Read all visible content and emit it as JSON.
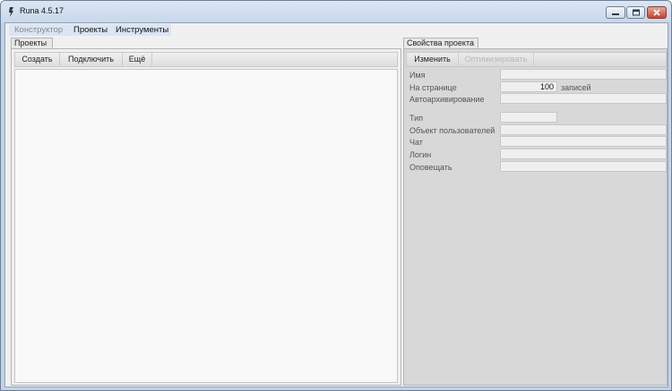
{
  "window": {
    "title": "Runa 4.5.17",
    "controls": [
      "minimize-icon",
      "maximize-icon",
      "close-icon"
    ]
  },
  "menu": {
    "items": [
      {
        "label": "Конструктор",
        "state": "disabled"
      },
      {
        "label": "Проекты",
        "state": "enabled"
      },
      {
        "label": "Инструменты",
        "state": "enabled"
      }
    ]
  },
  "projects_panel": {
    "tab_label": "Проекты",
    "toolbar": [
      {
        "label": "Создать",
        "state": "enabled"
      },
      {
        "label": "Подключить",
        "state": "enabled"
      },
      {
        "label": "Ещё",
        "state": "enabled"
      }
    ]
  },
  "properties_panel": {
    "tab_label": "Свойства проекта",
    "toolbar": [
      {
        "label": "Изменить",
        "state": "enabled"
      },
      {
        "label": "Оптимизировать",
        "state": "disabled"
      }
    ],
    "fields": {
      "name": {
        "label": "Имя",
        "value": ""
      },
      "per_page": {
        "label": "На странице",
        "value": "100",
        "suffix": "записей"
      },
      "autoarchive": {
        "label": "Автоархивирование",
        "value": ""
      },
      "type": {
        "label": "Тип",
        "value": ""
      },
      "user_object": {
        "label": "Объект пользователей",
        "value": ""
      },
      "chat": {
        "label": "Чат",
        "value": ""
      },
      "login": {
        "label": "Логин",
        "value": ""
      },
      "notify": {
        "label": "Оповещать",
        "value": ""
      }
    }
  }
}
